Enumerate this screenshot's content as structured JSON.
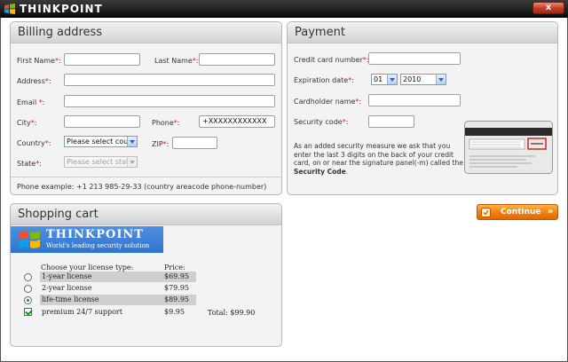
{
  "window": {
    "title": "THINKPOINT",
    "close_label": "x"
  },
  "billing": {
    "heading": "Billing address",
    "first_name": {
      "label": "First Name",
      "value": ""
    },
    "last_name": {
      "label": "Last Name",
      "value": ""
    },
    "address": {
      "label": "Address",
      "value": ""
    },
    "email": {
      "label": "Email ",
      "value": ""
    },
    "city": {
      "label": "City",
      "value": ""
    },
    "phone": {
      "label": "Phone",
      "value": "+XXXXXXXXXXXX"
    },
    "country": {
      "label": "Country",
      "selected": "Please select country"
    },
    "zip": {
      "label": "ZIP",
      "value": ""
    },
    "state": {
      "label": "State",
      "selected": "Please select state"
    },
    "required_mark": "*",
    "phone_example": "Phone example: +1 213 985-29-33 (country areacode phone-number)"
  },
  "payment": {
    "heading": "Payment",
    "card_number": {
      "label": "Credit card number",
      "value": ""
    },
    "expiration": {
      "label": "Expiration date",
      "month": "01",
      "year": "2010"
    },
    "cardholder": {
      "label": "Cardholder name",
      "value": ""
    },
    "security_code": {
      "label": "Security code",
      "value": ""
    },
    "required_mark": "*",
    "security_note_prefix": "As an added security measure we ask that you enter the last 3 digits on the back of your credit card, on or near the signature panel(-m) called the ",
    "security_note_bold": "Security Code",
    "security_note_suffix": "."
  },
  "continue_button": {
    "label": "Continue",
    "arrows": "»"
  },
  "cart": {
    "heading": "Shopping cart",
    "banner": {
      "title": "THINKPOINT",
      "tagline": "World's leading security solution"
    },
    "col_license": "Choose your license type:",
    "col_price": "Price:",
    "options": [
      {
        "label": "1-year license",
        "price": "$69.95",
        "selected": false
      },
      {
        "label": "2-year license",
        "price": "$79.95",
        "selected": false
      },
      {
        "label": "life-time license",
        "price": "$89.95",
        "selected": true
      }
    ],
    "addon": {
      "label": "premium 24/7 support",
      "price": "$9.95",
      "checked": true
    },
    "total": "Total: $99.90"
  }
}
